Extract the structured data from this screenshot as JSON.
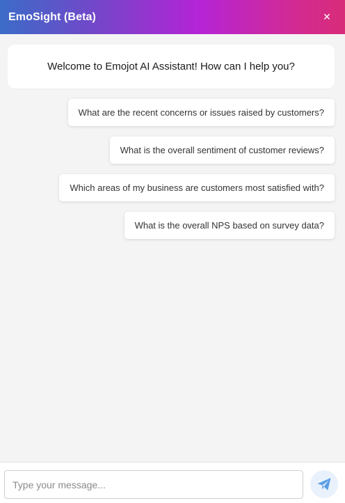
{
  "header": {
    "title": "EmoSight (Beta)",
    "close_icon_glyph": "✕",
    "gradient_colors": [
      "#3b6cc8",
      "#7446c9",
      "#b524d6",
      "#d22a93",
      "#d92c79"
    ]
  },
  "welcome": {
    "text": "Welcome to Emojot AI Assistant! How can I help you?"
  },
  "suggestions": [
    {
      "label": "What are the recent concerns or issues raised by customers?"
    },
    {
      "label": "What is the overall sentiment of customer reviews?"
    },
    {
      "label": "Which areas of my business are customers most satisfied with?"
    },
    {
      "label": "What is the overall NPS based on survey data?"
    }
  ],
  "composer": {
    "placeholder": "Type your message...",
    "value": "",
    "send_icon": "paper-plane-icon",
    "send_icon_color": "#5a9ee6"
  }
}
